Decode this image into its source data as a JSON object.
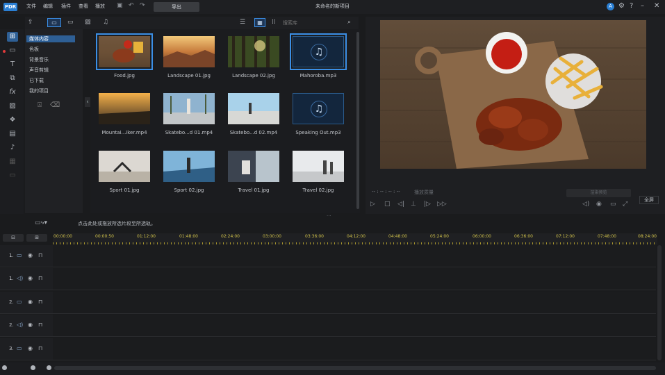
{
  "app": {
    "logo": "PDR",
    "window_title": "未命名的新项目",
    "undo_label": "导出",
    "menu": [
      "文件",
      "编辑",
      "插件",
      "查看",
      "播放"
    ]
  },
  "rail": {
    "icons": [
      "media-room-icon",
      "title-room-icon",
      "text-icon",
      "transition-icon",
      "fx-icon",
      "pip-icon",
      "particle-icon",
      "subtitle-icon",
      "voice-icon",
      "chapter-icon",
      "subtitle2-icon"
    ]
  },
  "tree": {
    "items": [
      "媒体内容",
      "色板",
      "背景音乐",
      "声音剪辑",
      "已下载",
      "我的项目"
    ]
  },
  "library": {
    "search_placeholder": "搜索库",
    "items": [
      {
        "name": "Food.jpg",
        "kind": "image"
      },
      {
        "name": "Landscape 01.jpg",
        "kind": "image"
      },
      {
        "name": "Landscape 02.jpg",
        "kind": "image"
      },
      {
        "name": "Mahoroba.mp3",
        "kind": "audio"
      },
      {
        "name": "Mountai...iker.mp4",
        "kind": "video"
      },
      {
        "name": "Skatebo...d 01.mp4",
        "kind": "video"
      },
      {
        "name": "Skatebo...d 02.mp4",
        "kind": "video"
      },
      {
        "name": "Speaking Out.mp3",
        "kind": "audio"
      },
      {
        "name": "Sport 01.jpg",
        "kind": "image"
      },
      {
        "name": "Sport 02.jpg",
        "kind": "image"
      },
      {
        "name": "Travel 01.jpg",
        "kind": "image"
      },
      {
        "name": "Travel 02.jpg",
        "kind": "image"
      }
    ]
  },
  "preview": {
    "timecode": "-- : -- : -- : --",
    "quality": "播放质量",
    "quality_btn": "渲染预览",
    "zoom": "全屏"
  },
  "timeline": {
    "hint": "点击此处或拖放所选片段至所选轨。",
    "ruler": [
      "00:00:00",
      "00:00:50",
      "01:12:00",
      "01:48:00",
      "02:24:00",
      "03:00:00",
      "03:36:00",
      "04:12:00",
      "04:48:00",
      "05:24:00",
      "06:00:00",
      "06:36:00",
      "07:12:00",
      "07:48:00",
      "08:24:00"
    ],
    "tracks": [
      {
        "num": "1.",
        "type": "video"
      },
      {
        "num": "1.",
        "type": "audio"
      },
      {
        "num": "2.",
        "type": "video"
      },
      {
        "num": "2.",
        "type": "audio"
      },
      {
        "num": "3.",
        "type": "video"
      },
      {
        "num": "3.",
        "type": "audio"
      }
    ]
  },
  "colors": {
    "accent": "#3b8fe6",
    "ruler_text": "#cfc04a",
    "selection": "#2e5f95"
  }
}
